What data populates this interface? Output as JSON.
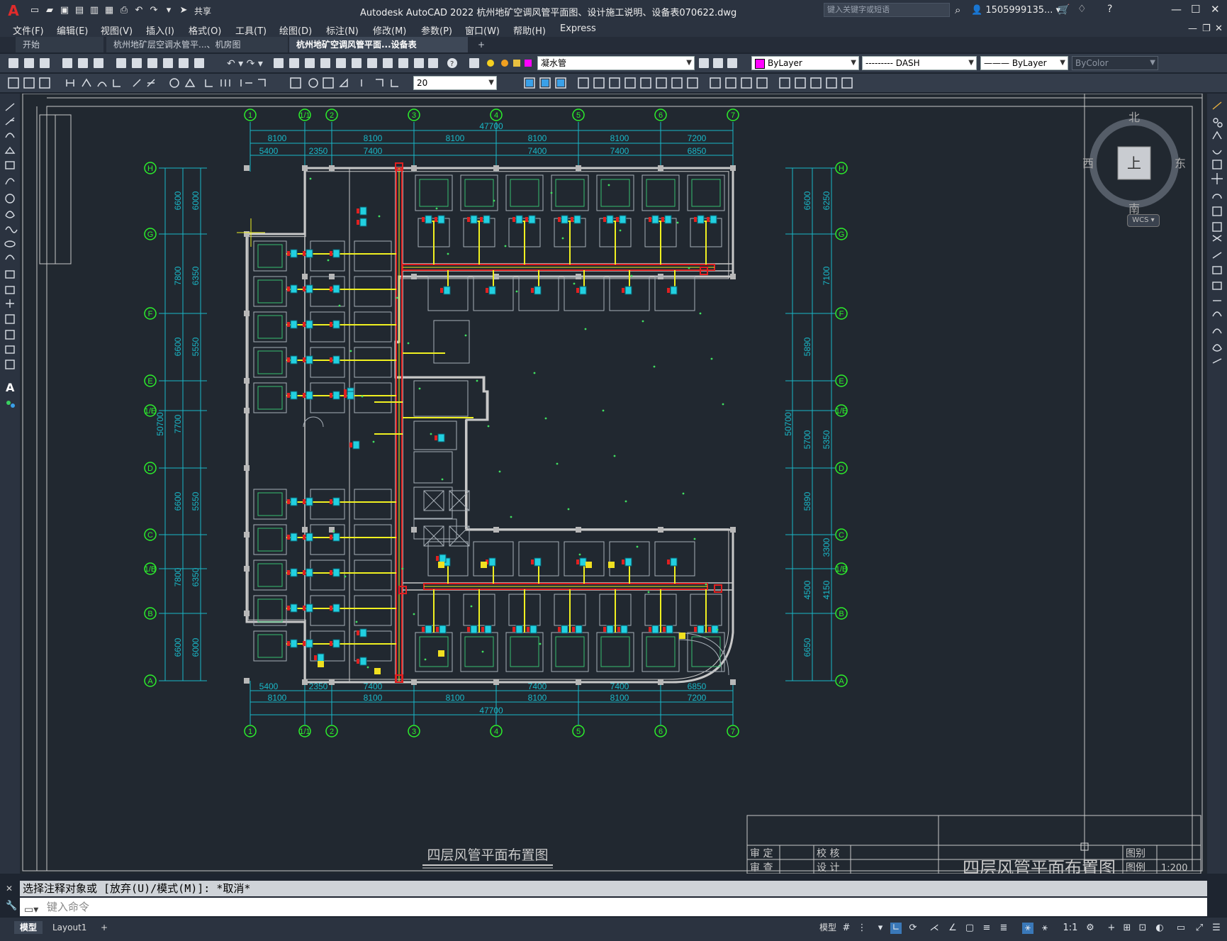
{
  "app": {
    "title": "Autodesk AutoCAD 2022    杭州地矿空调风管平面图、设计施工说明、设备表070622.dwg",
    "share_label": "共享",
    "search_placeholder": "键入关键字或短语",
    "user_name": "1505999135..."
  },
  "menu": [
    "文件(F)",
    "编辑(E)",
    "视图(V)",
    "插入(I)",
    "格式(O)",
    "工具(T)",
    "绘图(D)",
    "标注(N)",
    "修改(M)",
    "参数(P)",
    "窗口(W)",
    "帮助(H)",
    "Express"
  ],
  "tabs": [
    {
      "label": "开始"
    },
    {
      "label": "杭州地矿层空调水管平...、机房图070622"
    },
    {
      "label": "杭州地矿空调风管平面...设备表070622*"
    }
  ],
  "toolbar": {
    "layer_name": "凝水管",
    "color": "ByLayer",
    "linetype": "--------- DASH",
    "lineweight": "——— ByLayer",
    "plotstyle": "ByColor",
    "dim_value": "20",
    "layer_color_hex": "#ff00ff"
  },
  "viewcube": {
    "north": "北",
    "south": "南",
    "east": "东",
    "west": "西",
    "top": "上",
    "wcs": "WCS"
  },
  "drawing": {
    "title": "四层风管平面布置图",
    "grid_top": [
      "1",
      "1/1",
      "2",
      "3",
      "4",
      "5",
      "6",
      "7"
    ],
    "grid_side": [
      "H",
      "G",
      "F",
      "E",
      "1/E",
      "D",
      "C",
      "1/B",
      "B",
      "A"
    ],
    "dims_top_row1": [
      "8100",
      "8100",
      "8100",
      "8100",
      "8100",
      "7200"
    ],
    "dims_top_row2": [
      "5400",
      "2350",
      "7400",
      "7400",
      "7400",
      "6850"
    ],
    "dims_bottom_row1": [
      "5400",
      "2350",
      "7400",
      "7400",
      "7400",
      "6850"
    ],
    "dims_bottom_row2": [
      "8100",
      "8100",
      "8100",
      "8100",
      "8100",
      "7200"
    ],
    "dim_total": "47700",
    "dims_left_outer": [
      "6600",
      "7800",
      "6600",
      "7700",
      "6600",
      "7800",
      "6600"
    ],
    "dims_left_inner": [
      "6000",
      "6350",
      "5550",
      "5550",
      "6350",
      "6000"
    ],
    "dim_left_total": "50700",
    "dims_right_outer": [
      "6600",
      "5890",
      "5700",
      "5890",
      "4500",
      "6650"
    ],
    "dims_right_inner": [
      "6250",
      "7100",
      "5350",
      "4150",
      "3300"
    ],
    "titleblock": {
      "row1": [
        "审 定",
        "校 核",
        "图别"
      ],
      "row2": [
        "审 查",
        "设 计",
        "图例",
        "1:200"
      ],
      "name": "四层风管平面布置图"
    }
  },
  "command": {
    "history": "选择注释对象或 [放弃(U)/模式(M)]: *取消*",
    "placeholder": "键入命令"
  },
  "status": {
    "layout_tabs": [
      "模型",
      "Layout1"
    ],
    "model_label": "模型",
    "scale": "1:1"
  },
  "colors": {
    "canvas": "#212830",
    "grid_circle": "#2cf02c",
    "wall": "#c8c8c8",
    "duct_main": "#e02020",
    "duct_branch": "#f0f020",
    "equipment": "#22d0e0",
    "dims": "#19b8c8"
  }
}
